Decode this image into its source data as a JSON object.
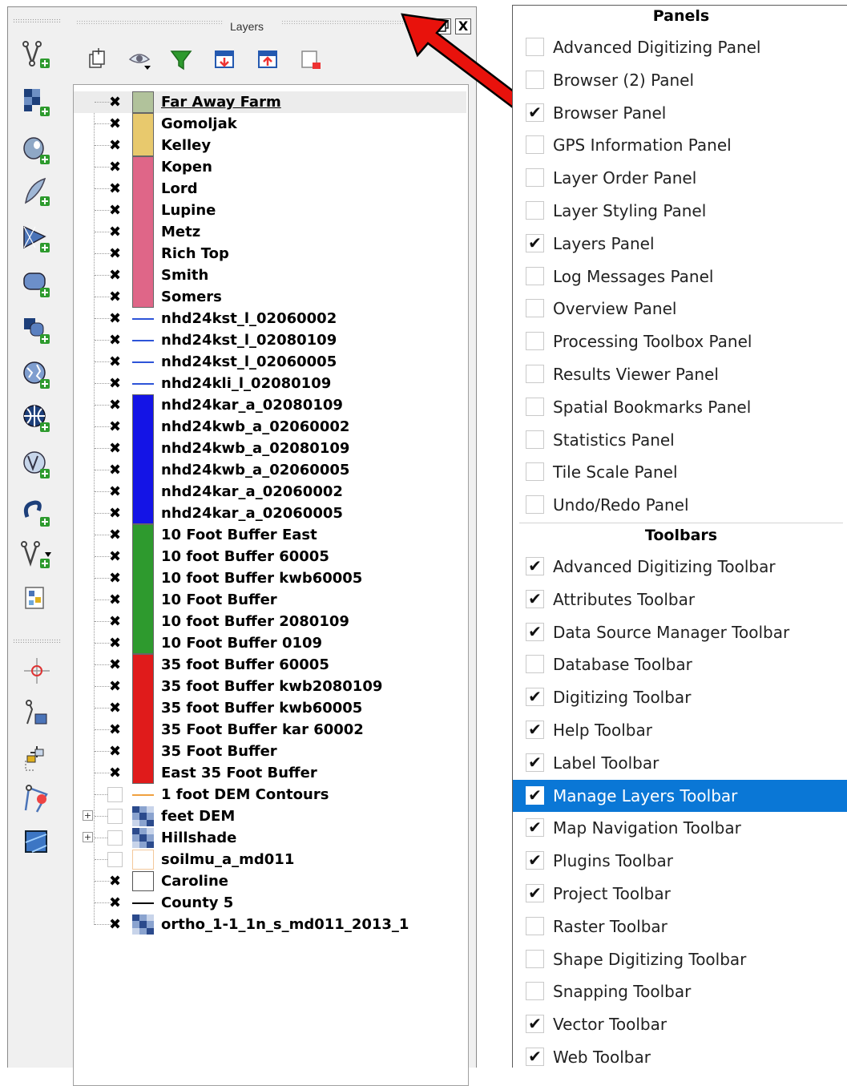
{
  "dock": {
    "title": "Layers",
    "close_glyph": "X",
    "toolbar_icons": [
      "add-group-icon",
      "manage-visibility-icon",
      "filter-legend-icon",
      "expand-all-icon",
      "collapse-all-icon",
      "remove-layer-icon"
    ]
  },
  "left_toolbar": {
    "icons": [
      "new-vector-layer-icon",
      "add-raster-layer-icon",
      "add-postgis-layer-icon",
      "add-spatialite-layer-icon",
      "add-mesh-layer-icon",
      "add-virtual-layer-icon",
      "add-wms-layer-icon",
      "add-wcs-layer-icon",
      "add-xyz-layer-icon",
      "add-wfs-layer-icon",
      "add-delimited-text-icon",
      "new-temporary-layer-icon",
      "layer-from-geopackage-icon",
      "digitizing-cursor-icon",
      "add-feature-icon",
      "move-feature-icon",
      "node-tool-icon",
      "split-features-icon"
    ]
  },
  "layers": [
    {
      "name": "Far Away Farm",
      "checked": true,
      "symbol": "fill",
      "color": "#b1c29b",
      "selected": true
    },
    {
      "name": "Gomoljak",
      "checked": true,
      "symbol": "fill",
      "color": "#e8c96d"
    },
    {
      "name": "Kelley",
      "checked": true,
      "symbol": "fill",
      "color": "#e8c96d"
    },
    {
      "name": "Kopen",
      "checked": true,
      "symbol": "fill",
      "color": "#df6688"
    },
    {
      "name": "Lord",
      "checked": true,
      "symbol": "fill",
      "color": "#df6688"
    },
    {
      "name": "Lupine",
      "checked": true,
      "symbol": "fill",
      "color": "#df6688"
    },
    {
      "name": "Metz",
      "checked": true,
      "symbol": "fill",
      "color": "#df6688"
    },
    {
      "name": "Rich Top",
      "checked": true,
      "symbol": "fill",
      "color": "#df6688"
    },
    {
      "name": "Smith",
      "checked": true,
      "symbol": "fill",
      "color": "#df6688"
    },
    {
      "name": "Somers",
      "checked": true,
      "symbol": "fill",
      "color": "#df6688"
    },
    {
      "name": "nhd24kst_l_02060002",
      "checked": true,
      "symbol": "line",
      "color": "#2d54d8"
    },
    {
      "name": "nhd24kst_l_02080109",
      "checked": true,
      "symbol": "line",
      "color": "#2d54d8"
    },
    {
      "name": "nhd24kst_l_02060005",
      "checked": true,
      "symbol": "line",
      "color": "#2d54d8"
    },
    {
      "name": "nhd24kli_l_02080109",
      "checked": true,
      "symbol": "line",
      "color": "#2d54d8"
    },
    {
      "name": "nhd24kar_a_02080109",
      "checked": true,
      "symbol": "fill",
      "color": "#1414e6"
    },
    {
      "name": "nhd24kwb_a_02060002",
      "checked": true,
      "symbol": "fill",
      "color": "#1414e6"
    },
    {
      "name": "nhd24kwb_a_02080109",
      "checked": true,
      "symbol": "fill",
      "color": "#1414e6"
    },
    {
      "name": "nhd24kwb_a_02060005",
      "checked": true,
      "symbol": "fill",
      "color": "#1414e6"
    },
    {
      "name": "nhd24kar_a_02060002",
      "checked": true,
      "symbol": "fill",
      "color": "#1414e6"
    },
    {
      "name": "nhd24kar_a_02060005",
      "checked": true,
      "symbol": "fill",
      "color": "#1414e6"
    },
    {
      "name": "10 Foot Buffer East",
      "checked": true,
      "symbol": "fill",
      "color": "#2e9a2e"
    },
    {
      "name": "10 foot Buffer 60005",
      "checked": true,
      "symbol": "fill",
      "color": "#2e9a2e"
    },
    {
      "name": "10 foot Buffer kwb60005",
      "checked": true,
      "symbol": "fill",
      "color": "#2e9a2e"
    },
    {
      "name": "10 Foot Buffer",
      "checked": true,
      "symbol": "fill",
      "color": "#2e9a2e"
    },
    {
      "name": "10 foot Buffer 2080109",
      "checked": true,
      "symbol": "fill",
      "color": "#2e9a2e"
    },
    {
      "name": "10 Foot Buffer 0109",
      "checked": true,
      "symbol": "fill",
      "color": "#2e9a2e"
    },
    {
      "name": "35 foot Buffer 60005",
      "checked": true,
      "symbol": "fill",
      "color": "#e01b1b"
    },
    {
      "name": "35 foot Buffer kwb2080109",
      "checked": true,
      "symbol": "fill",
      "color": "#e01b1b"
    },
    {
      "name": "35 foot Buffer kwb60005",
      "checked": true,
      "symbol": "fill",
      "color": "#e01b1b"
    },
    {
      "name": "35 Foot Buffer kar 60002",
      "checked": true,
      "symbol": "fill",
      "color": "#e01b1b"
    },
    {
      "name": "35 Foot Buffer",
      "checked": true,
      "symbol": "fill",
      "color": "#e01b1b"
    },
    {
      "name": "East 35 Foot Buffer",
      "checked": true,
      "symbol": "fill",
      "color": "#e01b1b"
    },
    {
      "name": "1 foot DEM Contours",
      "checked": false,
      "symbol": "line",
      "color": "#f0a040"
    },
    {
      "name": "feet DEM",
      "checked": false,
      "symbol": "raster",
      "color": "#2b4a8c",
      "expandable": true
    },
    {
      "name": "Hillshade",
      "checked": false,
      "symbol": "raster",
      "color": "#2b4a8c",
      "expandable": true
    },
    {
      "name": "soilmu_a_md011",
      "checked": false,
      "symbol": "outline",
      "color": "#f3c89b"
    },
    {
      "name": "Caroline",
      "checked": true,
      "symbol": "outline",
      "color": "#555555"
    },
    {
      "name": "County 5",
      "checked": true,
      "symbol": "line",
      "color": "#000000"
    },
    {
      "name": "ortho_1-1_1n_s_md011_2013_1",
      "checked": true,
      "symbol": "raster",
      "color": "#2b4a8c"
    }
  ],
  "menu": {
    "panels_title": "Panels",
    "panels": [
      {
        "label": "Advanced Digitizing Panel",
        "checked": false
      },
      {
        "label": "Browser (2) Panel",
        "checked": false
      },
      {
        "label": "Browser Panel",
        "checked": true
      },
      {
        "label": "GPS Information Panel",
        "checked": false
      },
      {
        "label": "Layer Order Panel",
        "checked": false
      },
      {
        "label": "Layer Styling Panel",
        "checked": false
      },
      {
        "label": "Layers Panel",
        "checked": true
      },
      {
        "label": "Log Messages Panel",
        "checked": false
      },
      {
        "label": "Overview Panel",
        "checked": false
      },
      {
        "label": "Processing Toolbox Panel",
        "checked": false
      },
      {
        "label": "Results Viewer Panel",
        "checked": false
      },
      {
        "label": "Spatial Bookmarks Panel",
        "checked": false
      },
      {
        "label": "Statistics Panel",
        "checked": false
      },
      {
        "label": "Tile Scale Panel",
        "checked": false
      },
      {
        "label": "Undo/Redo Panel",
        "checked": false
      }
    ],
    "toolbars_title": "Toolbars",
    "toolbars": [
      {
        "label": "Advanced Digitizing Toolbar",
        "checked": true
      },
      {
        "label": "Attributes Toolbar",
        "checked": true
      },
      {
        "label": "Data Source Manager Toolbar",
        "checked": true
      },
      {
        "label": "Database Toolbar",
        "checked": false
      },
      {
        "label": "Digitizing Toolbar",
        "checked": true
      },
      {
        "label": "Help Toolbar",
        "checked": true
      },
      {
        "label": "Label Toolbar",
        "checked": true
      },
      {
        "label": "Manage Layers Toolbar",
        "checked": true,
        "highlighted": true
      },
      {
        "label": "Map Navigation Toolbar",
        "checked": true
      },
      {
        "label": "Plugins Toolbar",
        "checked": true
      },
      {
        "label": "Project Toolbar",
        "checked": true
      },
      {
        "label": "Raster Toolbar",
        "checked": false
      },
      {
        "label": "Shape Digitizing Toolbar",
        "checked": false
      },
      {
        "label": "Snapping Toolbar",
        "checked": false
      },
      {
        "label": "Vector Toolbar",
        "checked": true
      },
      {
        "label": "Web Toolbar",
        "checked": true
      }
    ]
  },
  "colors": {
    "highlight": "#0a77d6",
    "arrow": "#e8120c"
  }
}
